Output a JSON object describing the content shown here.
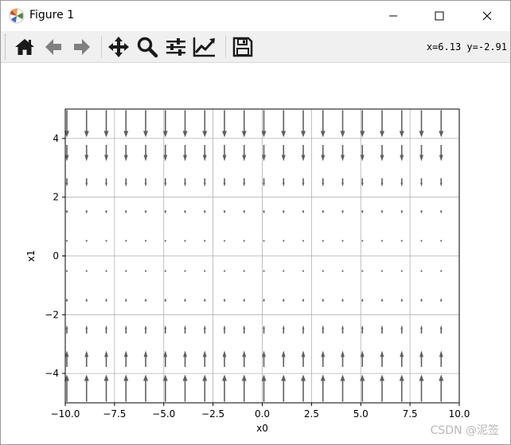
{
  "window": {
    "title": "Figure 1",
    "icon": "matplotlib-icon",
    "controls": [
      "minimize-icon",
      "maximize-icon",
      "close-icon"
    ]
  },
  "toolbar": {
    "buttons": [
      {
        "name": "home",
        "icon": "home-icon"
      },
      {
        "name": "back",
        "icon": "arrow-left-icon"
      },
      {
        "name": "forward",
        "icon": "arrow-right-icon"
      },
      {
        "name": "pan",
        "icon": "move-icon"
      },
      {
        "name": "zoom",
        "icon": "magnifier-icon"
      },
      {
        "name": "subplots",
        "icon": "sliders-icon"
      },
      {
        "name": "edit-axes",
        "icon": "line-chart-icon"
      },
      {
        "name": "save",
        "icon": "floppy-disk-icon"
      }
    ],
    "coordinates": "x=6.13 y=-2.91"
  },
  "colors": {
    "arrow": "#606060",
    "grid": "#b0b0b0",
    "toolbar_bg": "#f0f0f0",
    "icon": "#1a1a1a"
  },
  "chart_data": {
    "type": "quiver",
    "title": "",
    "xlabel": "x0",
    "ylabel": "x1",
    "xlim": [
      -10,
      10
    ],
    "ylim": [
      -5,
      5
    ],
    "xticks": [
      -10,
      -7.5,
      -5,
      -2.5,
      0,
      2.5,
      5,
      7.5,
      10
    ],
    "yticks": [
      -4,
      -2,
      0,
      2,
      4
    ],
    "xtick_labels": [
      "−10.0",
      "−7.5",
      "−5.0",
      "−2.5",
      "0.0",
      "2.5",
      "5.0",
      "7.5",
      "10.0"
    ],
    "ytick_labels": [
      "−4",
      "−2",
      "0",
      "2",
      "4"
    ],
    "grid": true,
    "arrow_x": [
      -10,
      -9,
      -8,
      -7,
      -6,
      -5,
      -4,
      -3,
      -2,
      -1,
      0,
      1,
      2,
      3,
      4,
      5,
      6,
      7,
      8,
      9
    ],
    "arrow_y": [
      -4.5,
      -3.5,
      -2.5,
      -1.5,
      -0.5,
      0.5,
      1.5,
      2.5,
      3.5,
      4.5
    ],
    "vector_field": "u = 0, v = -x1 * x1 * sign(x1) (arrows point toward x1 = 0; magnitude grows with |x1|)"
  },
  "watermark": "CSDN @泥签"
}
